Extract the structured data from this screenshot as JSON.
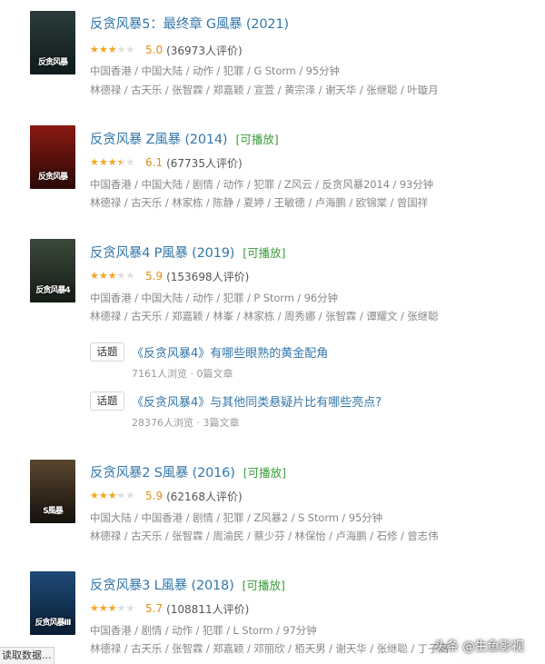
{
  "movies": [
    {
      "title": "反贪风暴5：最终章 G風暴 (2021)",
      "playable": "",
      "rating": 5.0,
      "score": "5.0",
      "votes": "(36973人评价)",
      "meta": "中国香港 / 中国大陆 / 动作 / 犯罪 / G Storm / 95分钟",
      "cast": "林德禄 / 古天乐 / 张智霖 / 郑嘉颖 / 宣萱 / 黄宗泽 / 谢天华 / 张继聪 / 叶璇月",
      "poster_colors": [
        "#2c3c3c",
        "#0f1a1c"
      ],
      "poster_text": "反贪风暴"
    },
    {
      "title": "反贪风暴 Z風暴 (2014)",
      "playable": "[可播放]",
      "rating": 6.1,
      "score": "6.1",
      "votes": "(67735人评价)",
      "meta": "中国香港 / 中国大陆 / 剧情 / 动作 / 犯罪 / Z风云 / 反贪风暴2014 / 93分钟",
      "cast": "林德禄 / 古天乐 / 林家栋 / 陈静 / 夏婷 / 王敏德 / 卢海鹏 / 欧锦棠 / 曾国祥",
      "poster_colors": [
        "#8a1a14",
        "#2a0806"
      ],
      "poster_text": "反贪风暴"
    },
    {
      "title": "反贪风暴4 P風暴 (2019)",
      "playable": "[可播放]",
      "rating": 5.9,
      "score": "5.9",
      "votes": "(153698人评价)",
      "meta": "中国香港 / 中国大陆 / 动作 / 犯罪 / P Storm / 96分钟",
      "cast": "林德禄 / 古天乐 / 郑嘉颖 / 林峯 / 林家栋 / 周秀娜 / 张智霖 / 谭耀文 / 张继聪",
      "poster_colors": [
        "#3b4a3a",
        "#141c16"
      ],
      "poster_text": "反贪风暴4"
    },
    {
      "title": "反贪风暴2 S風暴 (2016)",
      "playable": "[可播放]",
      "rating": 5.9,
      "score": "5.9",
      "votes": "(62168人评价)",
      "meta": "中国大陆 / 中国香港 / 剧情 / 犯罪 / Z风暴2 / S Storm / 95分钟",
      "cast": "林德禄 / 古天乐 / 张智霖 / 周渝民 / 蔡少芬 / 林保怡 / 卢海鹏 / 石修 / 曾志伟",
      "poster_colors": [
        "#5a4630",
        "#15110c"
      ],
      "poster_text": "S風暴"
    },
    {
      "title": "反贪风暴3 L風暴 (2018)",
      "playable": "[可播放]",
      "rating": 5.7,
      "score": "5.7",
      "votes": "(108811人评价)",
      "meta": "中国香港 / 剧情 / 动作 / 犯罪 / L Storm / 97分钟",
      "cast": "林德禄 / 古天乐 / 张智霖 / 郑嘉颖 / 邓丽欣 / 栢天男 / 谢天华 / 张继聪 / 丁子高",
      "poster_colors": [
        "#1e4a78",
        "#0a1d33"
      ],
      "poster_text": "反贪风暴III"
    }
  ],
  "topics": [
    {
      "tag": "话题",
      "title": "《反贪风暴4》有哪些眼熟的黄金配角",
      "stats": "7161人浏览 · 0篇文章"
    },
    {
      "tag": "话题",
      "title": "《反贪风暴4》与其他同类悬疑片比有哪些亮点?",
      "stats": "28376人浏览 · 3篇文章"
    }
  ],
  "status_bar": "读取数据...",
  "watermark": "头条 @生鱼影视"
}
